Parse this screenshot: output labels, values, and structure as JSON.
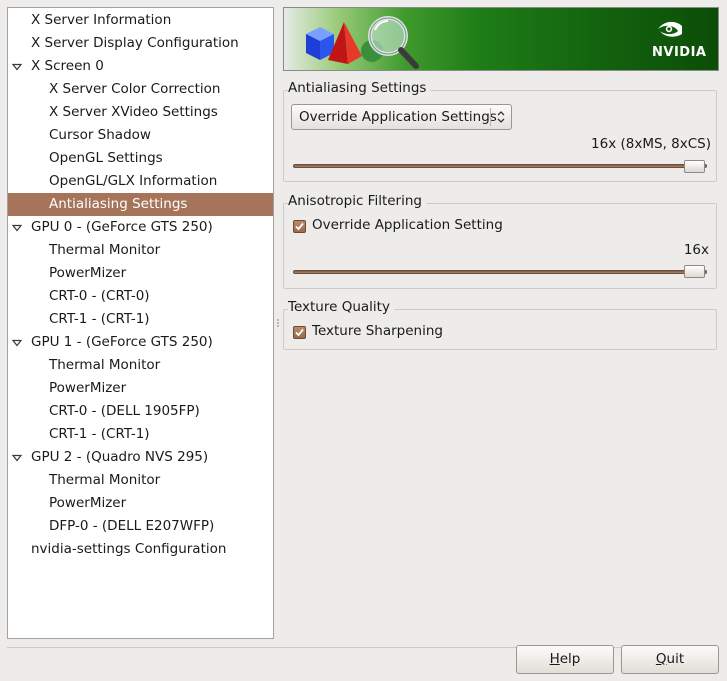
{
  "sidebar": {
    "items": [
      {
        "label": "X Server Information",
        "expander": "none"
      },
      {
        "label": "X Server Display Configuration",
        "expander": "none"
      },
      {
        "label": "X Screen 0",
        "expander": "expanded"
      },
      {
        "label": "X Server Color Correction",
        "expander": "none"
      },
      {
        "label": "X Server XVideo Settings",
        "expander": "none"
      },
      {
        "label": "Cursor Shadow",
        "expander": "none"
      },
      {
        "label": "OpenGL Settings",
        "expander": "none"
      },
      {
        "label": "OpenGL/GLX Information",
        "expander": "none"
      },
      {
        "label": "Antialiasing Settings",
        "expander": "none",
        "selected": true
      },
      {
        "label": "GPU 0 - (GeForce GTS 250)",
        "expander": "expanded"
      },
      {
        "label": "Thermal Monitor",
        "expander": "none"
      },
      {
        "label": "PowerMizer",
        "expander": "none"
      },
      {
        "label": "CRT-0 - (CRT-0)",
        "expander": "none"
      },
      {
        "label": "CRT-1 - (CRT-1)",
        "expander": "none"
      },
      {
        "label": "GPU 1 - (GeForce GTS 250)",
        "expander": "expanded"
      },
      {
        "label": "Thermal Monitor",
        "expander": "none"
      },
      {
        "label": "PowerMizer",
        "expander": "none"
      },
      {
        "label": "CRT-0 - (DELL 1905FP)",
        "expander": "none"
      },
      {
        "label": "CRT-1 - (CRT-1)",
        "expander": "none"
      },
      {
        "label": "GPU 2 - (Quadro NVS 295)",
        "expander": "expanded"
      },
      {
        "label": "Thermal Monitor",
        "expander": "none"
      },
      {
        "label": "PowerMizer",
        "expander": "none"
      },
      {
        "label": "DFP-0 - (DELL E207WFP)",
        "expander": "none"
      },
      {
        "label": "nvidia-settings Configuration",
        "expander": "none"
      }
    ]
  },
  "banner": {
    "logo_text": "NVIDIA",
    "brand_color": "#76b900"
  },
  "antialiasing": {
    "title": "Antialiasing Settings",
    "mode_selected": "Override Application Settings",
    "value_label": "16x (8xMS, 8xCS)",
    "slider_level": 1.0
  },
  "anisotropic": {
    "title": "Anisotropic Filtering",
    "override_label": "Override Application Setting",
    "override_checked": true,
    "value_label": "16x",
    "slider_level": 1.0
  },
  "texture": {
    "title": "Texture Quality",
    "sharpening_label": "Texture Sharpening",
    "sharpening_checked": true
  },
  "buttons": {
    "help_mnemonic": "H",
    "help_rest": "elp",
    "quit_mnemonic": "Q",
    "quit_rest": "uit"
  },
  "colors": {
    "selection": "#a5745a",
    "accent": "#a88467",
    "window_bg": "#edeceb"
  }
}
